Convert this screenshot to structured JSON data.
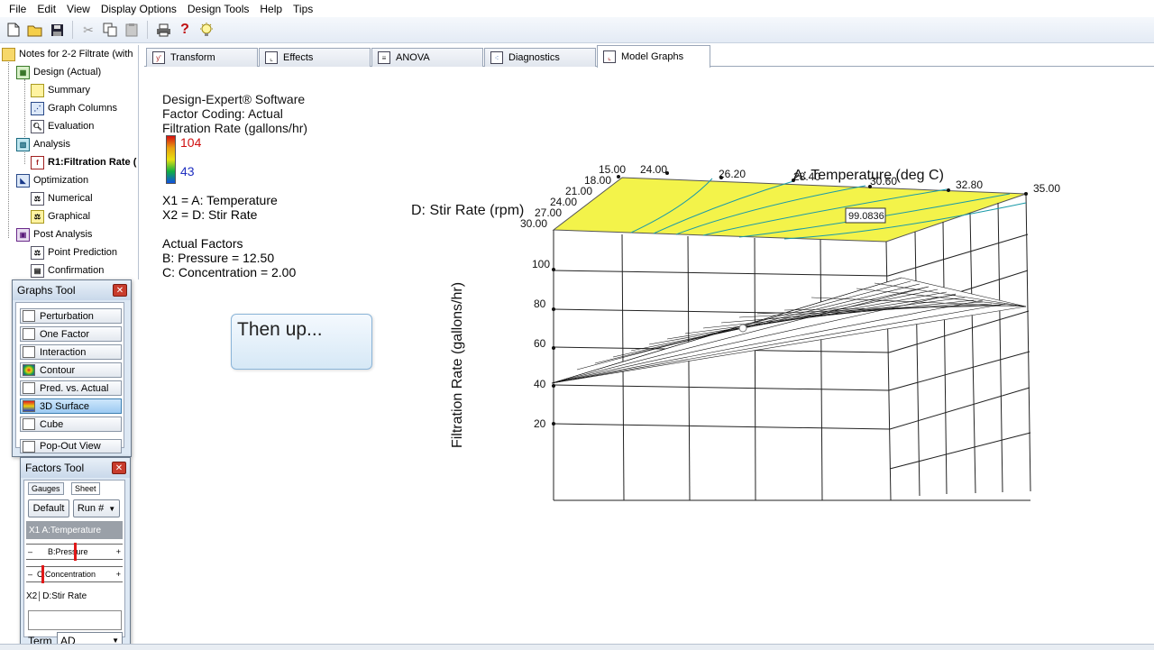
{
  "menu": [
    "File",
    "Edit",
    "View",
    "Display Options",
    "Design Tools",
    "Help",
    "Tips"
  ],
  "toolbar": {
    "icons": [
      "new-file-icon",
      "open-folder-icon",
      "save-icon",
      "cut-icon",
      "copy-icon",
      "paste-icon",
      "print-icon",
      "help-icon",
      "tip-bulb-icon"
    ],
    "help_glyph": "?"
  },
  "tree": {
    "root": "Notes for 2-2 Filtrate (with",
    "design": "Design (Actual)",
    "summary": "Summary",
    "graph_columns": "Graph Columns",
    "evaluation": "Evaluation",
    "analysis": "Analysis",
    "response": "R1:Filtration Rate (",
    "optimization": "Optimization",
    "numerical": "Numerical",
    "graphical": "Graphical",
    "post_analysis": "Post Analysis",
    "point_prediction": "Point Prediction",
    "confirmation": "Confirmation"
  },
  "tabs": [
    "Transform",
    "Effects",
    "ANOVA",
    "Diagnostics",
    "Model Graphs"
  ],
  "info": {
    "software": "Design-Expert® Software",
    "coding": "Factor Coding: Actual",
    "response": "Filtration Rate (gallons/hr)",
    "legend_high": "104",
    "legend_low": "43",
    "x1": "X1 = A: Temperature",
    "x2": "X2 = D: Stir Rate",
    "actual_factors": "Actual Factors",
    "pressure": "B: Pressure = 12.50",
    "concentration": "C: Concentration = 2.00"
  },
  "callout": "Then up...",
  "chart_data": {
    "type": "surface",
    "xlabel": "A: Temperature (deg C)",
    "ylabel": "D: Stir Rate (rpm)",
    "zlabel": "Filtration Rate (gallons/hr)",
    "x_ticks": [
      "24.00",
      "26.20",
      "28.40",
      "30.60",
      "32.80",
      "35.00"
    ],
    "y_ticks": [
      "15.00",
      "18.00",
      "21.00",
      "24.00",
      "27.00",
      "30.00"
    ],
    "z_ticks": [
      "20",
      "40",
      "60",
      "80",
      "100"
    ],
    "flag_value": "99.0836",
    "legend_range": [
      43,
      104
    ]
  },
  "graphs_tool": {
    "title": "Graphs Tool",
    "buttons": [
      "Perturbation",
      "One Factor",
      "Interaction",
      "Contour",
      "Pred. vs. Actual",
      "3D Surface",
      "Cube",
      "Pop-Out View"
    ],
    "selected": "3D Surface"
  },
  "factors_tool": {
    "title": "Factors Tool",
    "tab_gauges": "Gauges",
    "tab_sheet": "Sheet",
    "default_btn": "Default",
    "run_btn": "Run #",
    "x1_label": "X1 A:Temperature",
    "pressure_label": "B:Pressure",
    "concentration_label": "C:Concentration",
    "x2_tag": "X2",
    "x2_label": "D:Stir Rate",
    "minus": "–",
    "plus": "+",
    "term_label": "Term",
    "term_value": "AD",
    "pressure_level": 0.5,
    "concentration_level": 0.1
  }
}
